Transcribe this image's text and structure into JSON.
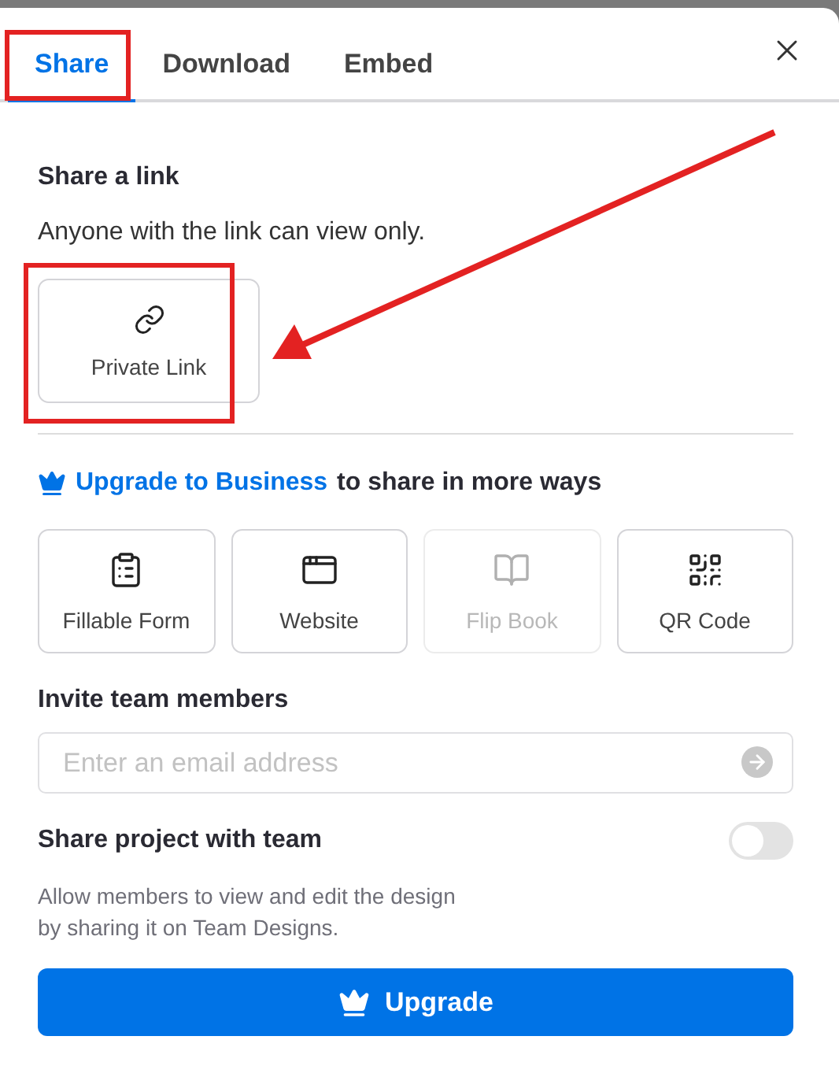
{
  "tabs": [
    {
      "label": "Share",
      "selected": true
    },
    {
      "label": "Download",
      "selected": false
    },
    {
      "label": "Embed",
      "selected": false
    }
  ],
  "share_link": {
    "heading": "Share a link",
    "description": "Anyone with the link can view only.",
    "options": [
      {
        "label": "Private Link",
        "kind": "link"
      }
    ]
  },
  "upgrade_note": {
    "link": "Upgrade to Business",
    "text": "to share in more ways"
  },
  "share_options": [
    {
      "label": "Fillable Form",
      "kind": "form",
      "disabled": false
    },
    {
      "label": "Website",
      "kind": "website",
      "disabled": false
    },
    {
      "label": "Flip Book",
      "kind": "book",
      "disabled": true
    },
    {
      "label": "QR Code",
      "kind": "qr",
      "disabled": false
    }
  ],
  "invite": {
    "heading": "Invite team members",
    "placeholder": "Enter an email address"
  },
  "team_share": {
    "label": "Share project with team",
    "on": false,
    "description": "Allow members to view and edit the design\nby sharing it on Team Designs."
  },
  "upgrade_button": {
    "label": "Upgrade"
  },
  "annotations": [
    {
      "kind": "tab-box"
    },
    {
      "kind": "link-box"
    },
    {
      "kind": "arrow"
    }
  ]
}
